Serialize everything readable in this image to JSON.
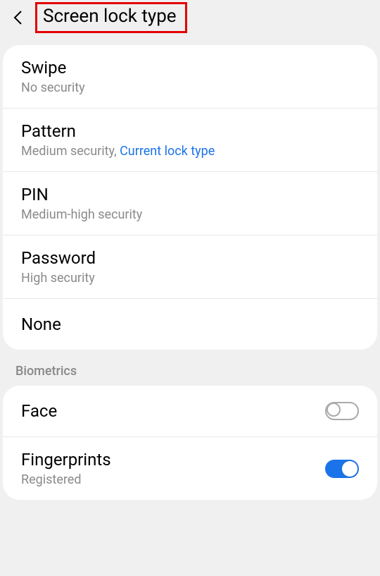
{
  "header": {
    "title": "Screen lock type"
  },
  "lockOptions": [
    {
      "title": "Swipe",
      "subtitle": "No security",
      "highlight": ""
    },
    {
      "title": "Pattern",
      "subtitle": "Medium security, ",
      "highlight": "Current lock type"
    },
    {
      "title": "PIN",
      "subtitle": "Medium-high security",
      "highlight": ""
    },
    {
      "title": "Password",
      "subtitle": "High security",
      "highlight": ""
    },
    {
      "title": "None",
      "subtitle": "",
      "highlight": ""
    }
  ],
  "biometrics": {
    "sectionTitle": "Biometrics",
    "items": [
      {
        "title": "Face",
        "subtitle": "",
        "enabled": false
      },
      {
        "title": "Fingerprints",
        "subtitle": "Registered",
        "enabled": true
      }
    ]
  }
}
